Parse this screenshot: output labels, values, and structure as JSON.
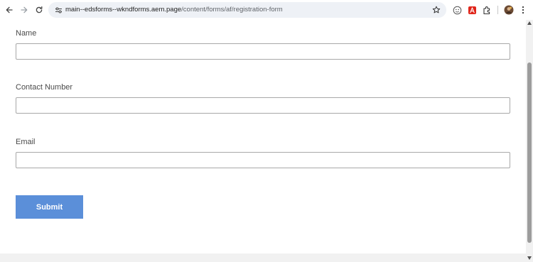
{
  "browser": {
    "url_host": "main--edsforms--wkndforms.aem.page",
    "url_path": "/content/forms/af/registration-form",
    "back_icon": "arrow-left-icon",
    "forward_icon": "arrow-right-icon",
    "reload_icon": "reload-icon",
    "site_info_icon": "tune-icon",
    "star_icon": "star-icon",
    "extensions": [
      "face-icon",
      "acrobat-icon",
      "puzzle-icon"
    ],
    "profile_icon": "avatar",
    "menu_icon": "kebab-menu-icon"
  },
  "form": {
    "fields": [
      {
        "label": "Name",
        "value": ""
      },
      {
        "label": "Contact Number",
        "value": ""
      },
      {
        "label": "Email",
        "value": ""
      }
    ],
    "submit_label": "Submit"
  },
  "colors": {
    "submit_bg": "#5b8fd9",
    "omnibox_bg": "#eef1f6",
    "input_border": "#a8a8a8"
  }
}
